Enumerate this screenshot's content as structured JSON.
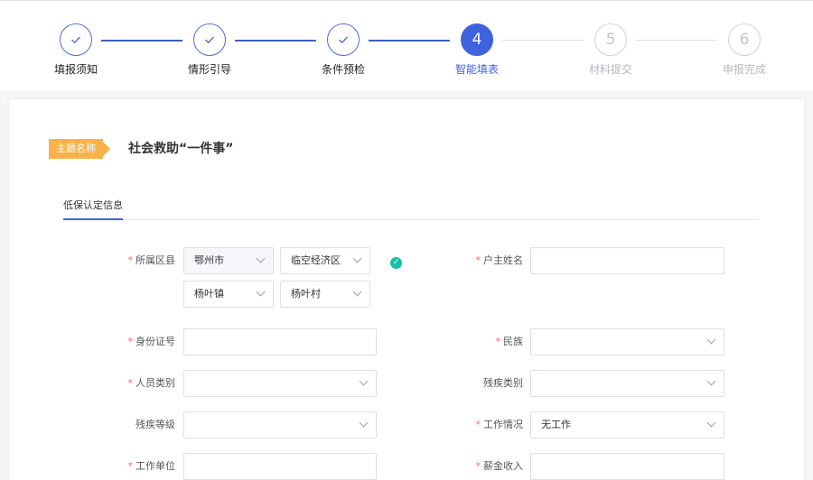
{
  "steps": [
    {
      "number": "1",
      "label": "填报须知",
      "state": "done"
    },
    {
      "number": "2",
      "label": "情形引导",
      "state": "done"
    },
    {
      "number": "3",
      "label": "条件预检",
      "state": "done"
    },
    {
      "number": "4",
      "label": "智能填表",
      "state": "active"
    },
    {
      "number": "5",
      "label": "材料提交",
      "state": "todo"
    },
    {
      "number": "6",
      "label": "申报完成",
      "state": "todo"
    }
  ],
  "theme": {
    "tag": "主题名称",
    "title": "社会救助“一件事”"
  },
  "tab": {
    "label": "低保认定信息"
  },
  "form": {
    "district": {
      "label": "所属区县",
      "city": "鄂州市",
      "zone": "临空经济区",
      "town": "杨叶镇",
      "village": "杨叶村"
    },
    "head_name": {
      "label": "户主姓名",
      "value": ""
    },
    "id_number": {
      "label": "身份证号",
      "value": ""
    },
    "ethnicity": {
      "label": "民族",
      "value": ""
    },
    "person_type": {
      "label": "人员类别",
      "value": ""
    },
    "disability_type": {
      "label": "残疾类别",
      "value": ""
    },
    "disability_level": {
      "label": "残疾等级",
      "value": ""
    },
    "work_status": {
      "label": "工作情况",
      "value": "无工作"
    },
    "employer": {
      "label": "工作单位",
      "value": ""
    },
    "salary": {
      "label": "薪金收入",
      "value": ""
    }
  },
  "colors": {
    "primary": "#3e63dd",
    "tag": "#f9b249",
    "required": "#f56c6c",
    "success": "#13c2a6"
  }
}
